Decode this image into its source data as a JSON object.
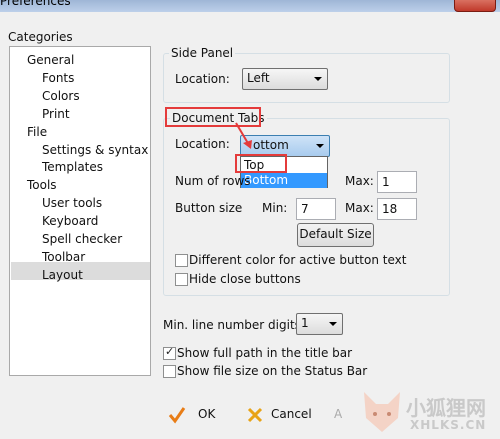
{
  "window": {
    "title": "Preferences"
  },
  "categories": {
    "label": "Categories",
    "items": [
      {
        "label": "General",
        "level": 0
      },
      {
        "label": "Fonts",
        "level": 1
      },
      {
        "label": "Colors",
        "level": 1
      },
      {
        "label": "Print",
        "level": 1
      },
      {
        "label": "File",
        "level": 0
      },
      {
        "label": "Settings & syntax",
        "level": 1
      },
      {
        "label": "Templates",
        "level": 1
      },
      {
        "label": "Tools",
        "level": 0
      },
      {
        "label": "User tools",
        "level": 1
      },
      {
        "label": "Keyboard",
        "level": 1
      },
      {
        "label": "Spell checker",
        "level": 1
      },
      {
        "label": "Toolbar",
        "level": 1
      },
      {
        "label": "Layout",
        "level": 1,
        "selected": true
      }
    ]
  },
  "side_panel": {
    "title": "Side Panel",
    "location_label": "Location:",
    "location_value": "Left"
  },
  "document_tabs": {
    "title": "Document Tabs",
    "location_label": "Location:",
    "location_value": "Bottom",
    "location_value_visible": "ottom",
    "dropdown_options": [
      "Top",
      "Bottom"
    ],
    "num_rows_label": "Num of rows",
    "max_label": "Max:",
    "max_rows_value": "1",
    "button_size_label": "Button size",
    "min_label": "Min:",
    "min_value": "7",
    "button_max_label": "Max:",
    "button_max_value": "18",
    "default_size_button": "Default Size",
    "different_color_label": "Different color for active button text",
    "hide_close_label": "Hide close buttons"
  },
  "min_line_digits": {
    "label": "Min. line number digits:",
    "value": "1"
  },
  "checkboxes": {
    "full_path": {
      "label": "Show full path in the title bar",
      "checked": true
    },
    "file_size": {
      "label": "Show file size on the Status Bar",
      "checked": false
    }
  },
  "buttons": {
    "ok": "OK",
    "cancel": "Cancel",
    "apply": "A"
  },
  "watermark": {
    "cn": "小狐狸网",
    "en": "XHLKS.CN"
  },
  "colors": {
    "highlight": "#3399ff",
    "annotation": "#e43b3b",
    "ok_icon": "#e87d17",
    "cancel_icon": "#e8a317"
  }
}
